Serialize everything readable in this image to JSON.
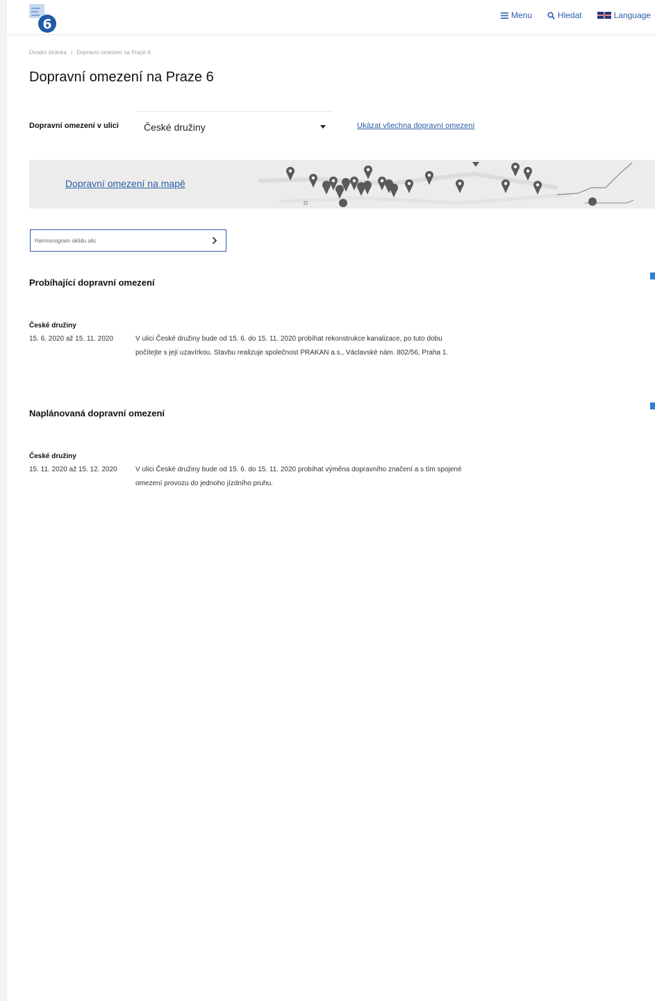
{
  "header": {
    "logo_number": "6",
    "nav": {
      "menu": "Menu",
      "search": "Hledat",
      "language": "Language"
    }
  },
  "breadcrumb": {
    "home": "Úvodní stránka",
    "current": "Dopravní omezení na Praze 6"
  },
  "page_title": "Dopravní omezení na Praze 6",
  "filter": {
    "label": "Dopravní omezení v ulici",
    "selected": "České družiny",
    "show_all_link": "Ukázat všechna dopravní omezení"
  },
  "map_banner": {
    "link": "Dopravní omezení na mapě"
  },
  "harmonogram": {
    "label": "Harmonogram úklidu ulic"
  },
  "ongoing": {
    "title": "Probíhající dopravní omezení",
    "items": [
      {
        "street": "České družiny",
        "date": "15. 6. 2020 až 15. 11. 2020",
        "desc_line1": "V ulici České družiny bude od 15. 6. do 15. 11. 2020 probíhat rekonstrukce kanalizace, po tuto dobu",
        "desc_line2": "počítejte s její uzavírkou. Stavbu realizuje společnost PRAKAN a.s., Václavské nám. 802/56, Praha 1."
      }
    ]
  },
  "planned": {
    "title": "Naplánovaná dopravní omezení",
    "items": [
      {
        "street": "České družiny",
        "date": "15. 11. 2020 až 15. 12. 2020",
        "desc_line1": "V ulici České družiny bude od 15. 6. do 15. 11. 2020 probíhat výměna dopravního značení a s tím spojené",
        "desc_line2": "omezení provozu do jednoho jízdního pruhu."
      }
    ]
  },
  "colors": {
    "accent": "#2e5ea8",
    "logo_blue": "#1f5aa6",
    "map_bg": "#ececec",
    "pin": "#555555"
  }
}
